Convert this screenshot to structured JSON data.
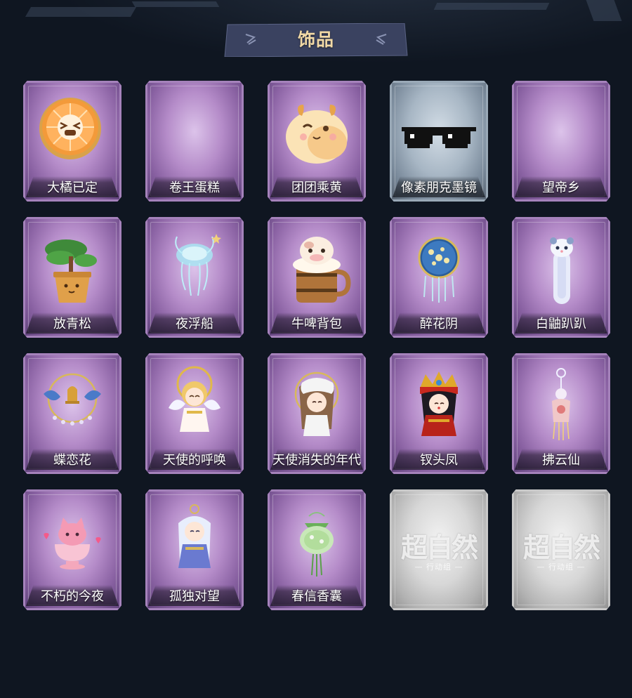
{
  "header": {
    "title": "饰品"
  },
  "colors": {
    "background": "#0f1621",
    "title_text": "#f1d9a6",
    "banner": "#3a4260",
    "rarity_purple": "#b58cc9",
    "rarity_blue": "#a7b6c4",
    "rarity_silver": "#d7d7d7"
  },
  "items": [
    {
      "label": "大橘已定",
      "rarity": "purple",
      "icon": "orange-slice-icon"
    },
    {
      "label": "卷王蛋糕",
      "rarity": "purple",
      "icon": "empty-icon"
    },
    {
      "label": "团团乘黄",
      "rarity": "purple",
      "icon": "round-creature-icon"
    },
    {
      "label": "像素朋克墨镜",
      "rarity": "blue",
      "icon": "pixel-sunglasses-icon"
    },
    {
      "label": "望帝乡",
      "rarity": "purple",
      "icon": "empty-icon"
    },
    {
      "label": "放青松",
      "rarity": "purple",
      "icon": "potted-pine-icon"
    },
    {
      "label": "夜浮船",
      "rarity": "purple",
      "icon": "jellyfish-icon"
    },
    {
      "label": "牛啤背包",
      "rarity": "purple",
      "icon": "cow-beer-mug-icon"
    },
    {
      "label": "醉花阴",
      "rarity": "purple",
      "icon": "floral-fan-icon"
    },
    {
      "label": "白鼬趴趴",
      "rarity": "purple",
      "icon": "white-ferret-icon"
    },
    {
      "label": "蝶恋花",
      "rarity": "purple",
      "icon": "butterfly-bell-icon"
    },
    {
      "label": "天使的呼唤",
      "rarity": "purple",
      "icon": "angel-doll-icon"
    },
    {
      "label": "天使消失的年代",
      "rarity": "purple",
      "icon": "veiled-girl-icon"
    },
    {
      "label": "钗头凤",
      "rarity": "purple",
      "icon": "phoenix-crown-doll-icon"
    },
    {
      "label": "拂云仙",
      "rarity": "purple",
      "icon": "tassel-charm-icon"
    },
    {
      "label": "不朽的今夜",
      "rarity": "purple",
      "icon": "pink-fox-teacup-icon"
    },
    {
      "label": "孤独对望",
      "rarity": "purple",
      "icon": "white-hair-doll-icon"
    },
    {
      "label": "春信香囊",
      "rarity": "purple",
      "icon": "green-sachet-icon"
    },
    {
      "label": "",
      "rarity": "silver",
      "icon": "placeholder-icon"
    },
    {
      "label": "",
      "rarity": "silver",
      "icon": "placeholder-icon"
    }
  ],
  "placeholder": {
    "mark": "超自然",
    "sub": "— 行动组 —"
  }
}
